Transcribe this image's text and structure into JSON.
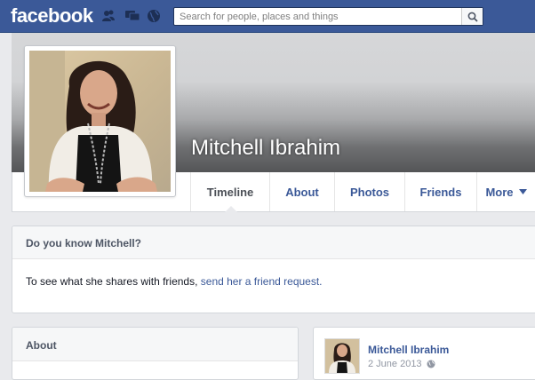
{
  "topbar": {
    "logo": "facebook",
    "search_placeholder": "Search for people, places and things"
  },
  "profile": {
    "name": "Mitchell Ibrahim"
  },
  "tabs": [
    {
      "label": "Timeline",
      "active": true
    },
    {
      "label": "About"
    },
    {
      "label": "Photos"
    },
    {
      "label": "Friends"
    },
    {
      "label": "More"
    }
  ],
  "know_card": {
    "title": "Do you know Mitchell?",
    "body_text": "To see what she shares with friends, ",
    "link_text": "send her a friend request."
  },
  "about_card": {
    "title": "About"
  },
  "post": {
    "author": "Mitchell Ibrahim",
    "date": "2 June 2013"
  },
  "colors": {
    "brand": "#3b5998",
    "background": "#e9eaed",
    "link": "#3b5998"
  }
}
